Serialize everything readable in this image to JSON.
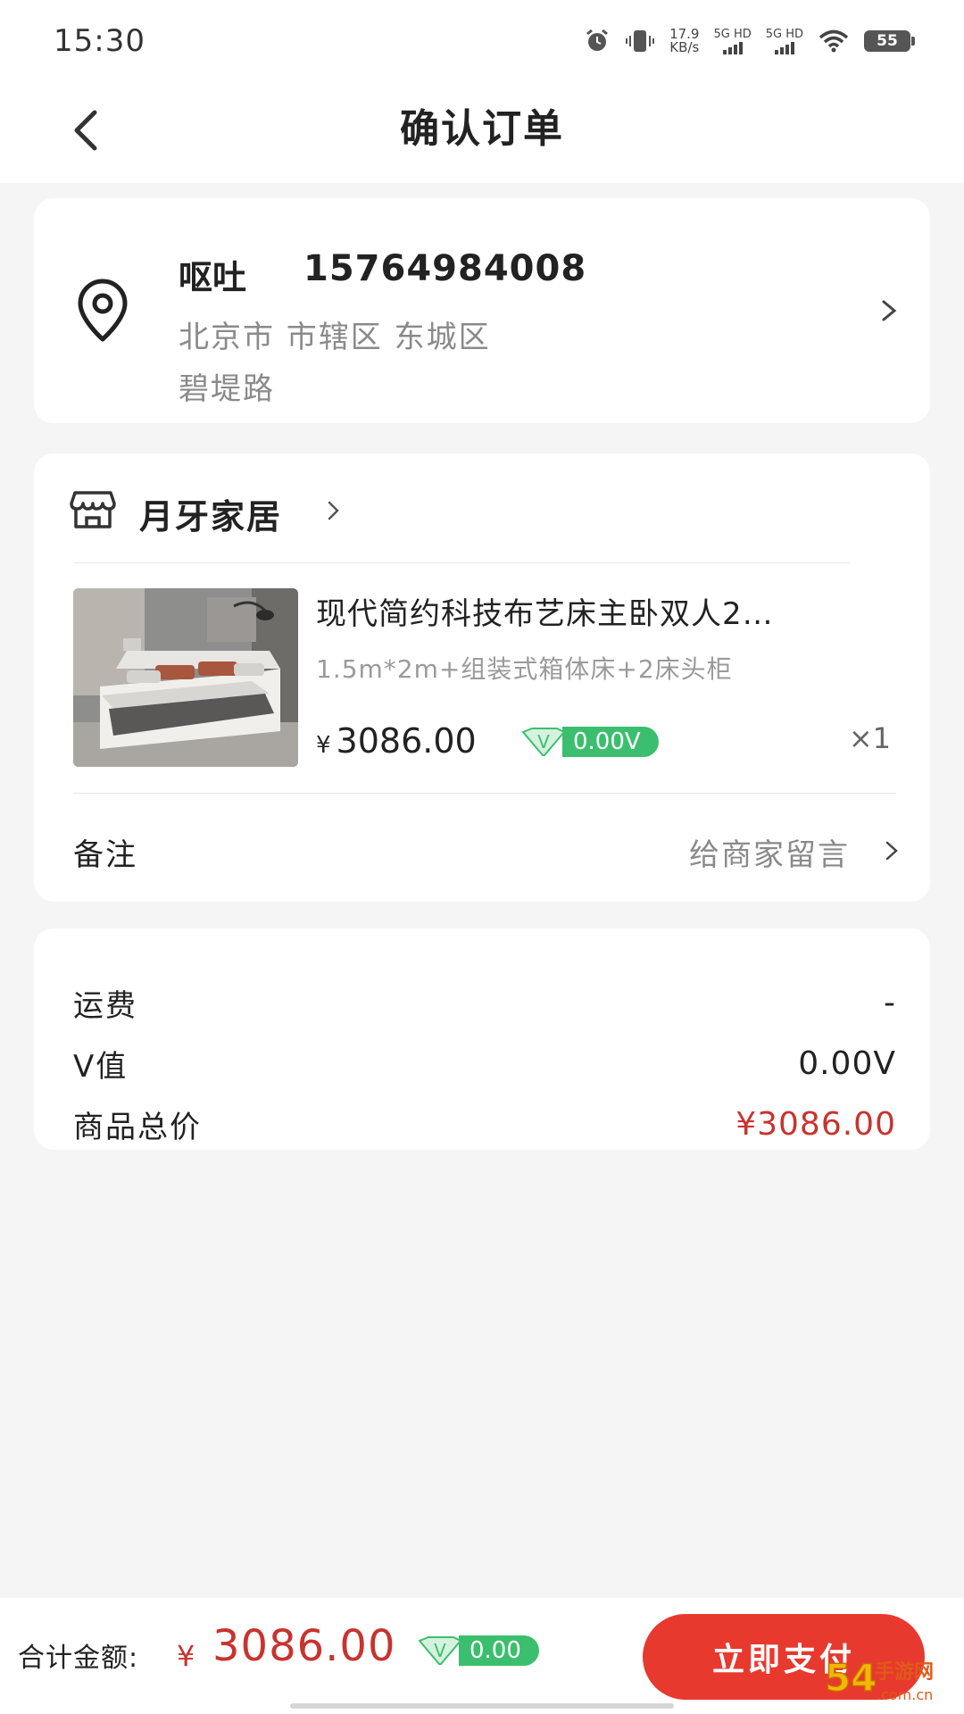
{
  "status_bar": {
    "time": "15:30",
    "net_speed_value": "17.9",
    "net_speed_unit": "KB/s",
    "sim1": "5G HD",
    "sim2": "5G HD",
    "battery": "55"
  },
  "header": {
    "title": "确认订单"
  },
  "address": {
    "name": "呕吐",
    "phone": "15764984008",
    "region": "北京市 市辖区 东城区",
    "street": "碧堤路"
  },
  "shop": {
    "name": "月牙家居"
  },
  "product": {
    "title": "现代简约科技布艺床主卧双人2…",
    "spec": "1.5m*2m+组装式箱体床+2床头柜",
    "currency": "¥",
    "price": "3086.00",
    "v_value": "0.00V",
    "quantity": "×1"
  },
  "remark": {
    "label": "备注",
    "placeholder": "给商家留言"
  },
  "summary": {
    "shipping_label": "运费",
    "shipping_value": "-",
    "v_label": "V值",
    "v_value": "0.00V",
    "total_label": "商品总价",
    "total_value": "¥3086.00"
  },
  "bottom_bar": {
    "total_label": "合计金额:",
    "currency": "¥",
    "total_amount": "3086.00",
    "v_value": "0.00",
    "pay_label": "立即支付"
  },
  "vtag_letter": "V",
  "watermark": {
    "number": "54",
    "text": "手游网",
    "domain": ".com.cn"
  },
  "colors": {
    "accent_red": "#e8392f",
    "price_red": "#c8332f",
    "v_green": "#3bbf6e"
  }
}
